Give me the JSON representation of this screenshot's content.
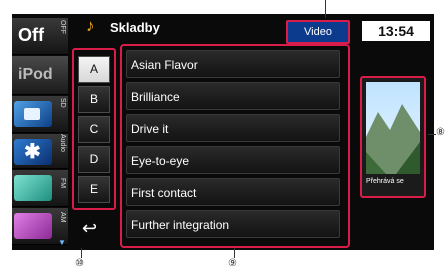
{
  "sources": {
    "off_label": "Off",
    "ipod_label": "iPod",
    "side_labels": [
      "OFF",
      "SD",
      "Audio",
      "FM",
      "AM"
    ]
  },
  "header": {
    "title": "Skladby",
    "video_tab": "Video",
    "clock": "13:54"
  },
  "letters": [
    "A",
    "B",
    "C",
    "D",
    "E"
  ],
  "active_letter_index": 0,
  "songs": [
    "Asian Flavor",
    "Brilliance",
    "Drive it",
    "Eye-to-eye",
    "First contact",
    "Further integration"
  ],
  "preview": {
    "caption": "Přehrává se"
  },
  "callouts": {
    "letters": "⑩",
    "list": "⑨",
    "preview": "⑧"
  },
  "icons": {
    "note": "music-note-icon",
    "sd": "sd-card-icon",
    "bluetooth": "bluetooth-icon",
    "fm": "fm-radio-icon",
    "am": "am-radio-icon",
    "back": "back-arrow-icon"
  },
  "colors": {
    "highlight": "#d81d4a",
    "accent": "#f2a81e",
    "tab": "#0c3a8c"
  }
}
